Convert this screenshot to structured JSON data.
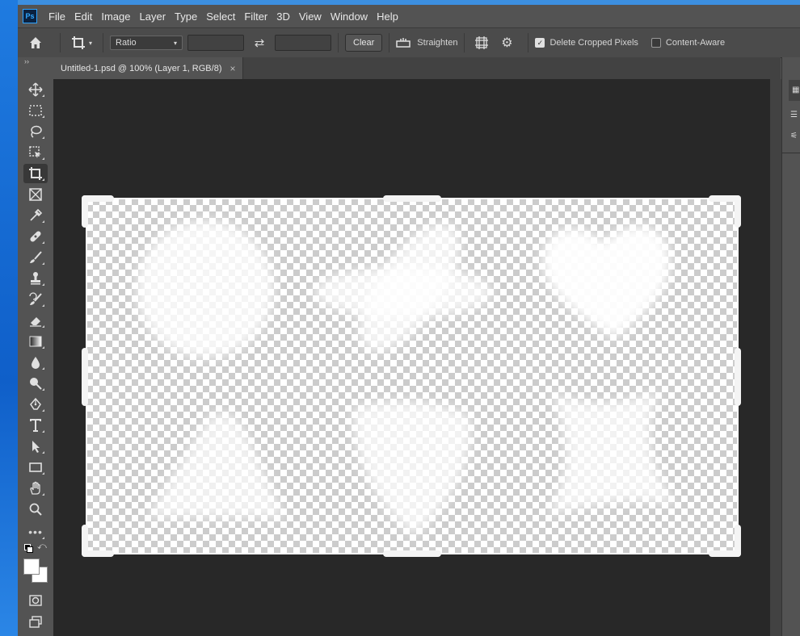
{
  "app": {
    "logo_text": "Ps"
  },
  "menu": [
    "File",
    "Edit",
    "Image",
    "Layer",
    "Type",
    "Select",
    "Filter",
    "3D",
    "View",
    "Window",
    "Help"
  ],
  "options": {
    "ratio_label": "Ratio",
    "clear_label": "Clear",
    "straighten_label": "Straighten",
    "delete_cropped_label": "Delete Cropped Pixels",
    "delete_cropped_checked": true,
    "content_aware_label": "Content-Aware",
    "content_aware_checked": false
  },
  "toolbar": {
    "collapse_glyph": "››"
  },
  "document": {
    "tab_title": "Untitled-1.psd @ 100% (Layer 1, RGB/8)",
    "close_glyph": "×"
  },
  "tools": [
    "move-icon",
    "marquee-icon",
    "lasso-icon",
    "object-select-icon",
    "crop-icon",
    "frame-icon",
    "eyedropper-icon",
    "healing-brush-icon",
    "brush-icon",
    "clone-stamp-icon",
    "history-brush-icon",
    "eraser-icon",
    "gradient-icon",
    "blur-icon",
    "dodge-icon",
    "pen-icon",
    "type-icon",
    "path-select-icon",
    "rectangle-icon",
    "hand-icon",
    "zoom-icon",
    "more-icon"
  ],
  "colors": {
    "foreground": "#ffffff",
    "background": "#ffffff",
    "ui_bg": "#535353",
    "canvas_bg": "#282828"
  }
}
